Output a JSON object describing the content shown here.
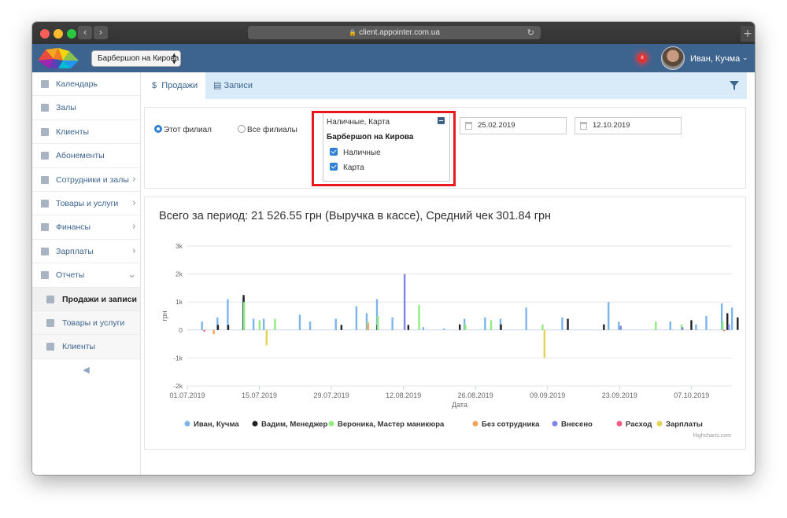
{
  "browser": {
    "url": "client.appointer.com.ua",
    "back_icon": "chevron-left",
    "forward_icon": "chevron-right"
  },
  "header": {
    "branch": "Барбершоп на Кирова",
    "notifications_count": "8",
    "user_name": "Иван, Кучма"
  },
  "sidebar": {
    "items": [
      {
        "label": "Календарь",
        "icon": "calendar-icon"
      },
      {
        "label": "Залы",
        "icon": "bookmark-icon"
      },
      {
        "label": "Клиенты",
        "icon": "users-icon"
      },
      {
        "label": "Абонементы",
        "icon": "card-icon"
      },
      {
        "label": "Сотрудники и залы",
        "icon": "id-card-icon"
      },
      {
        "label": "Товары и услуги",
        "icon": "credit-card-icon"
      },
      {
        "label": "Финансы",
        "icon": "money-icon"
      },
      {
        "label": "Зарплаты",
        "icon": "wallet-icon"
      },
      {
        "label": "Отчеты",
        "icon": "bar-chart-icon"
      }
    ],
    "sub_items": [
      {
        "label": "Продажи и записи",
        "icon": "line-chart-icon"
      },
      {
        "label": "Товары и услуги",
        "icon": "card-icon"
      },
      {
        "label": "Клиенты",
        "icon": "users-icon"
      }
    ]
  },
  "tabs": {
    "sales": "Продажи",
    "sales_prefix": "$",
    "records": "Записи"
  },
  "filters": {
    "this_branch": "Этот филиал",
    "all_branches": "Все филиалы",
    "payment_selected": "Наличные, Карта",
    "payment_group": "Барбершоп на Кирова",
    "payment_options": [
      "Наличные",
      "Карта"
    ],
    "date_from": "25.02.2019",
    "date_to": "12.10.2019"
  },
  "summary": "Всего за период: 21 526.55 грн (Выручка в кассе), Средний чек 301.84 грн",
  "credits": "Highcharts.com",
  "colors": {
    "accent": "#3d648f",
    "tabs_bg": "#d9eaf8",
    "highlight": "#e8181c"
  },
  "chart_data": {
    "type": "bar",
    "xlabel": "Дата",
    "ylabel": "грн",
    "ylim": [
      -2000,
      3000
    ],
    "y_ticks": [
      "-2k",
      "-1k",
      "0",
      "1k",
      "2k",
      "3k"
    ],
    "x_ticks": [
      "01.07.2019",
      "15.07.2019",
      "29.07.2019",
      "12.08.2019",
      "26.08.2019",
      "09.09.2019",
      "23.09.2019",
      "07.10.2019"
    ],
    "x_range": [
      "2019-07-01",
      "2019-10-13"
    ],
    "series": [
      {
        "name": "Иван, Кучма",
        "color": "#7cb5ec",
        "points": [
          [
            "2019-07-04",
            300
          ],
          [
            "2019-07-07",
            450
          ],
          [
            "2019-07-09",
            1100
          ],
          [
            "2019-07-12",
            1150
          ],
          [
            "2019-07-14",
            400
          ],
          [
            "2019-07-16",
            400
          ],
          [
            "2019-07-23",
            550
          ],
          [
            "2019-07-25",
            300
          ],
          [
            "2019-07-30",
            400
          ],
          [
            "2019-08-03",
            850
          ],
          [
            "2019-08-05",
            600
          ],
          [
            "2019-08-07",
            1100
          ],
          [
            "2019-08-10",
            450
          ],
          [
            "2019-08-16",
            100
          ],
          [
            "2019-08-20",
            50
          ],
          [
            "2019-08-24",
            400
          ],
          [
            "2019-08-28",
            450
          ],
          [
            "2019-08-31",
            400
          ],
          [
            "2019-09-05",
            800
          ],
          [
            "2019-09-12",
            450
          ],
          [
            "2019-09-21",
            1000
          ],
          [
            "2019-09-23",
            300
          ],
          [
            "2019-10-03",
            300
          ],
          [
            "2019-10-08",
            200
          ],
          [
            "2019-10-10",
            500
          ],
          [
            "2019-10-13",
            950
          ],
          [
            "2019-10-15",
            800
          ]
        ]
      },
      {
        "name": "Вадим, Менеджер",
        "color": "#222222",
        "points": [
          [
            "2019-07-07",
            180
          ],
          [
            "2019-07-09",
            180
          ],
          [
            "2019-07-12",
            1250
          ],
          [
            "2019-07-31",
            180
          ],
          [
            "2019-08-07",
            180
          ],
          [
            "2019-08-13",
            180
          ],
          [
            "2019-08-23",
            200
          ],
          [
            "2019-08-31",
            200
          ],
          [
            "2019-09-13",
            400
          ],
          [
            "2019-09-20",
            200
          ],
          [
            "2019-10-07",
            350
          ],
          [
            "2019-10-14",
            600
          ],
          [
            "2019-10-16",
            450
          ]
        ]
      },
      {
        "name": "Вероника, Мастер маникюра",
        "color": "#90ed7d",
        "points": [
          [
            "2019-07-12",
            1000
          ],
          [
            "2019-07-15",
            350
          ],
          [
            "2019-07-18",
            400
          ],
          [
            "2019-08-05",
            300
          ],
          [
            "2019-08-07",
            500
          ],
          [
            "2019-08-15",
            900
          ],
          [
            "2019-08-24",
            200
          ],
          [
            "2019-08-29",
            350
          ],
          [
            "2019-09-08",
            200
          ],
          [
            "2019-09-30",
            300
          ],
          [
            "2019-10-05",
            200
          ],
          [
            "2019-10-13",
            300
          ]
        ]
      },
      {
        "name": "Без сотрудника",
        "color": "#f7a35c",
        "points": [
          [
            "2019-07-06",
            -150
          ],
          [
            "2019-08-05",
            250
          ]
        ]
      },
      {
        "name": "Внесено",
        "color": "#8085e9",
        "points": [
          [
            "2019-08-12",
            2000
          ],
          [
            "2019-09-23",
            150
          ],
          [
            "2019-10-05",
            100
          ],
          [
            "2019-10-14",
            200
          ]
        ]
      },
      {
        "name": "Расход",
        "color": "#f15c80",
        "points": [
          [
            "2019-07-04",
            -60
          ],
          [
            "2019-10-13",
            -40
          ]
        ]
      },
      {
        "name": "Зарплаты",
        "color": "#e4d354",
        "points": [
          [
            "2019-07-16",
            -550
          ],
          [
            "2019-09-08",
            -1000
          ]
        ]
      }
    ]
  }
}
